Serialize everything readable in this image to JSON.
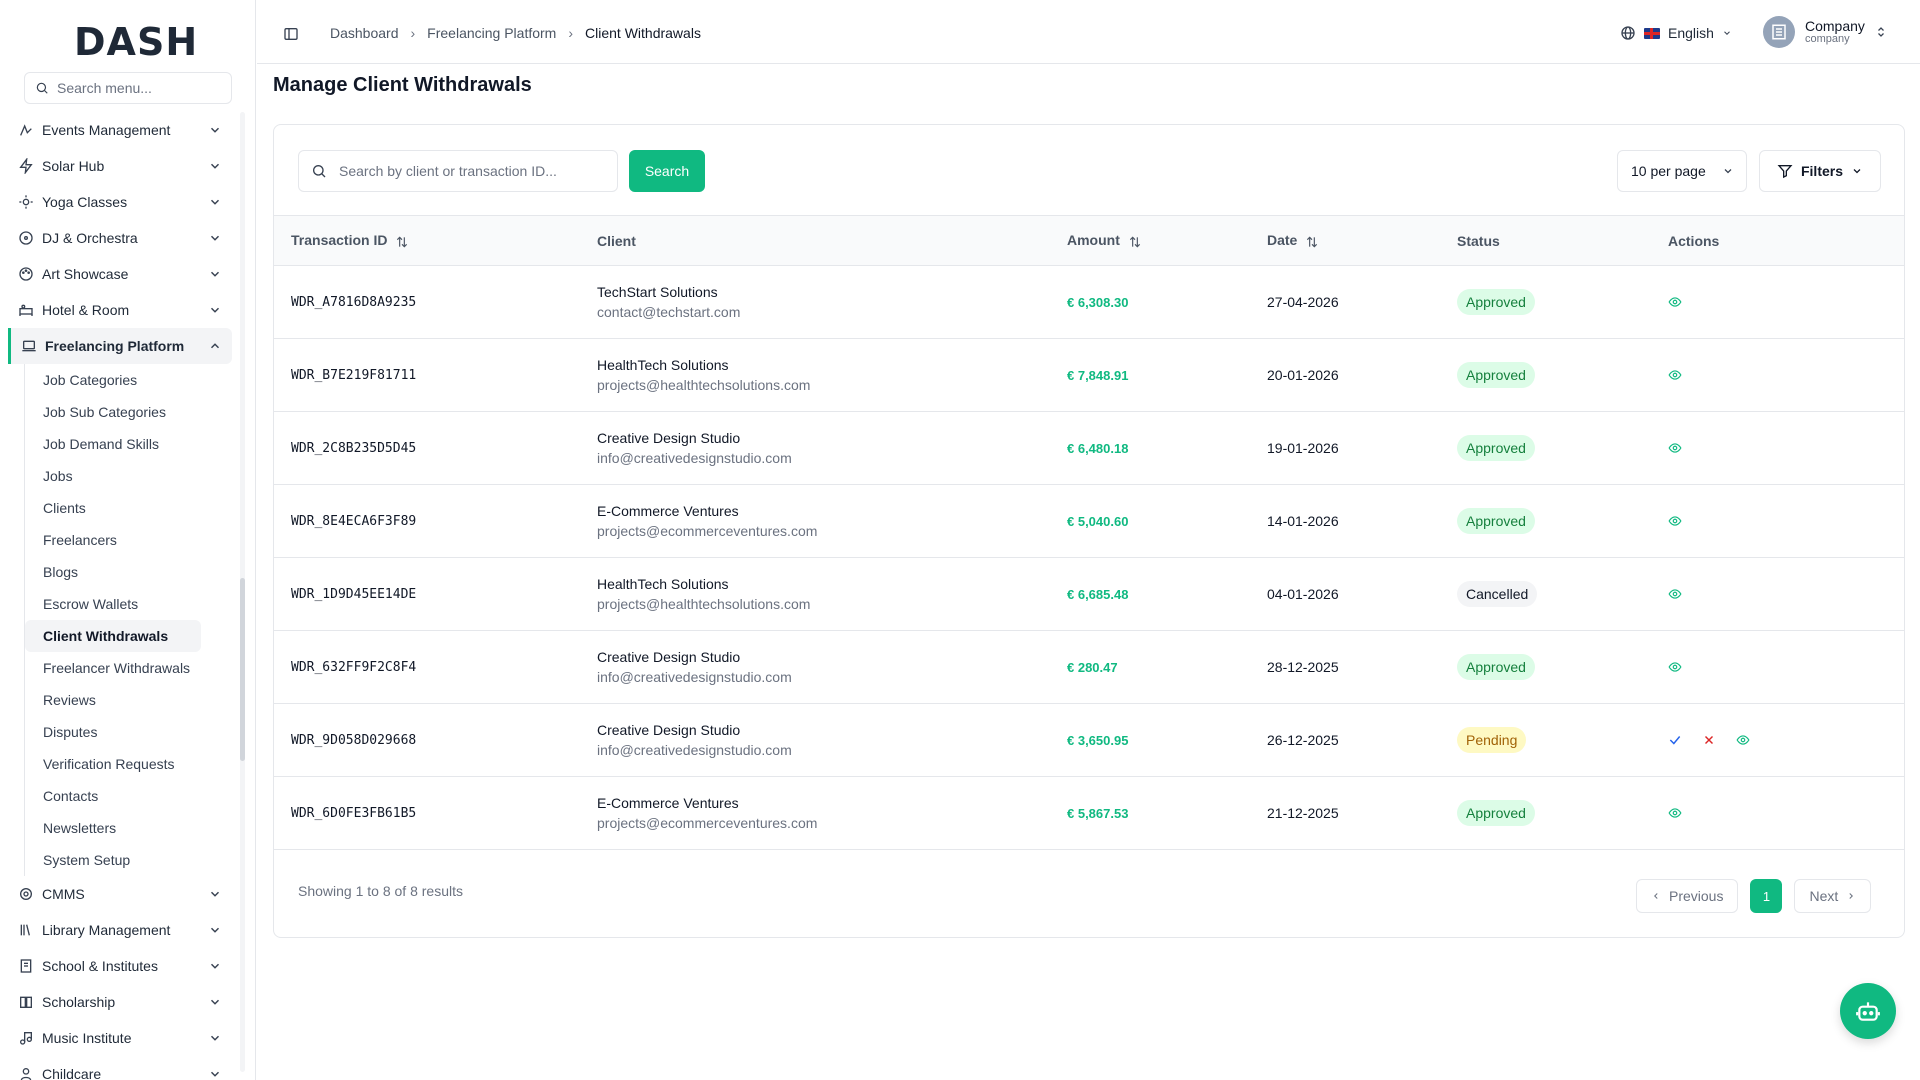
{
  "brand": {
    "logo": "DASH"
  },
  "sidebar": {
    "search_placeholder": "Search menu...",
    "menu": [
      {
        "label": "Events Management",
        "icon": "events-icon"
      },
      {
        "label": "Solar Hub",
        "icon": "bolt-icon"
      },
      {
        "label": "Yoga Classes",
        "icon": "sun-icon"
      },
      {
        "label": "DJ & Orchestra",
        "icon": "disc-icon"
      },
      {
        "label": "Art Showcase",
        "icon": "palette-icon"
      },
      {
        "label": "Hotel & Room",
        "icon": "hotel-icon"
      },
      {
        "label": "Freelancing Platform",
        "icon": "laptop-icon"
      }
    ],
    "submenu": [
      "Job Categories",
      "Job Sub Categories",
      "Job Demand Skills",
      "Jobs",
      "Clients",
      "Freelancers",
      "Blogs",
      "Escrow Wallets",
      "Client Withdrawals",
      "Freelancer Withdrawals",
      "Reviews",
      "Disputes",
      "Verification Requests",
      "Contacts",
      "Newsletters",
      "System Setup"
    ],
    "menu_after": [
      {
        "label": "CMMS",
        "icon": "cog-icon"
      },
      {
        "label": "Library Management",
        "icon": "library-icon"
      },
      {
        "label": "School & Institutes",
        "icon": "school-icon"
      },
      {
        "label": "Scholarship",
        "icon": "book-icon"
      },
      {
        "label": "Music Institute",
        "icon": "music-icon"
      },
      {
        "label": "Childcare",
        "icon": "child-icon"
      }
    ]
  },
  "header": {
    "breadcrumbs": [
      "Dashboard",
      "Freelancing Platform",
      "Client Withdrawals"
    ],
    "language": "English",
    "user_name": "Company",
    "user_role": "company"
  },
  "main": {
    "title": "Manage Client Withdrawals",
    "search_placeholder": "Search by client or transaction ID...",
    "search_button": "Search",
    "per_page": "10 per page",
    "filters": "Filters",
    "columns": [
      "Transaction ID",
      "Client",
      "Amount",
      "Date",
      "Status",
      "Actions"
    ],
    "rows": [
      {
        "id": "WDR_A7816D8A9235",
        "client": "TechStart Solutions",
        "email": "contact@techstart.com",
        "amount": "€ 6,308.30",
        "date": "27-04-2026",
        "status": "Approved"
      },
      {
        "id": "WDR_B7E219F81711",
        "client": "HealthTech Solutions",
        "email": "projects@healthtechsolutions.com",
        "amount": "€ 7,848.91",
        "date": "20-01-2026",
        "status": "Approved"
      },
      {
        "id": "WDR_2C8B235D5D45",
        "client": "Creative Design Studio",
        "email": "info@creativedesignstudio.com",
        "amount": "€ 6,480.18",
        "date": "19-01-2026",
        "status": "Approved"
      },
      {
        "id": "WDR_8E4ECA6F3F89",
        "client": "E-Commerce Ventures",
        "email": "projects@ecommerceventures.com",
        "amount": "€ 5,040.60",
        "date": "14-01-2026",
        "status": "Approved"
      },
      {
        "id": "WDR_1D9D45EE14DE",
        "client": "HealthTech Solutions",
        "email": "projects@healthtechsolutions.com",
        "amount": "€ 6,685.48",
        "date": "04-01-2026",
        "status": "Cancelled"
      },
      {
        "id": "WDR_632FF9F2C8F4",
        "client": "Creative Design Studio",
        "email": "info@creativedesignstudio.com",
        "amount": "€ 280.47",
        "date": "28-12-2025",
        "status": "Approved"
      },
      {
        "id": "WDR_9D058D029668",
        "client": "Creative Design Studio",
        "email": "info@creativedesignstudio.com",
        "amount": "€ 3,650.95",
        "date": "26-12-2025",
        "status": "Pending"
      },
      {
        "id": "WDR_6D0FE3FB61B5",
        "client": "E-Commerce Ventures",
        "email": "projects@ecommerceventures.com",
        "amount": "€ 5,867.53",
        "date": "21-12-2025",
        "status": "Approved"
      }
    ],
    "footer_text": "Showing 1 to 8 of 8 results",
    "prev": "Previous",
    "next": "Next",
    "page": "1"
  },
  "colors": {
    "accent": "#10b981",
    "approved_bg": "#dcfce7",
    "pending_bg": "#fef9c3"
  }
}
